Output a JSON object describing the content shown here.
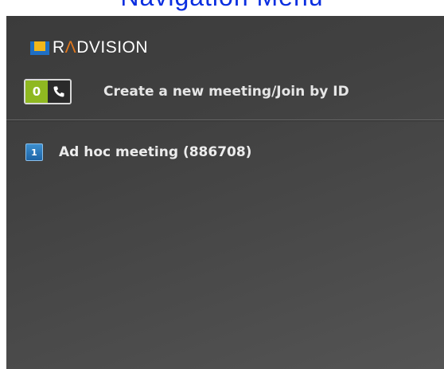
{
  "header_strip": {
    "text": "Navigation Menu"
  },
  "logo": {
    "prefix": "R",
    "accent": "Λ",
    "suffix": "DVISION"
  },
  "create_row": {
    "key": "0",
    "icon": "phone-icon",
    "label": "Create a new meeting/Join by ID"
  },
  "meetings": [
    {
      "index": "1",
      "label": "Ad hoc meeting (886708)"
    }
  ],
  "colors": {
    "brand_blue": "#1f6fc4",
    "brand_yellow": "#f2b71a",
    "brand_accent": "#e0771d",
    "key_green": "#8fb821",
    "badge_blue": "#2a78bd",
    "header_link": "#0a2ee0"
  }
}
